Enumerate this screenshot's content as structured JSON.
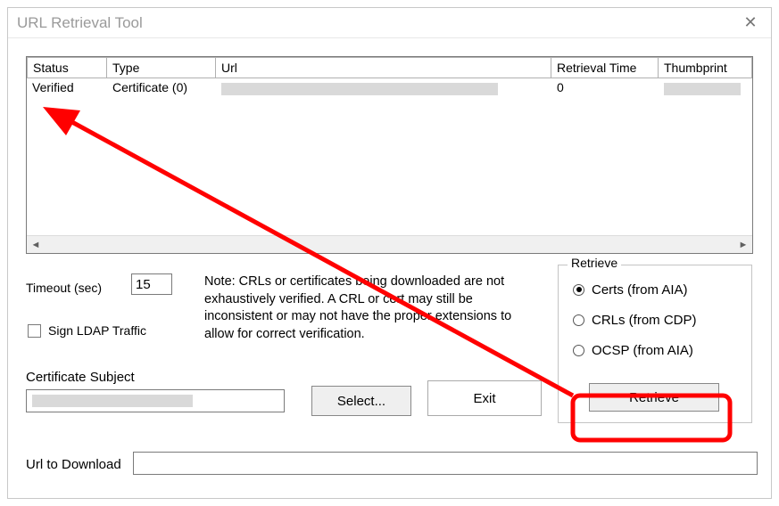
{
  "window": {
    "title": "URL Retrieval Tool"
  },
  "table": {
    "headers": {
      "status": "Status",
      "type": "Type",
      "url": "Url",
      "retrieval_time": "Retrieval Time",
      "thumbprint": "Thumbprint"
    },
    "rows": [
      {
        "status": "Verified",
        "type": "Certificate (0)",
        "url": "",
        "retrieval_time": "0",
        "thumbprint": ""
      }
    ]
  },
  "form": {
    "timeout_label": "Timeout (sec)",
    "timeout_value": "15",
    "sign_ldap_label": "Sign LDAP Traffic",
    "note": "Note: CRLs or certificates being downloaded are not exhaustively verified.  A CRL or cert may still be inconsistent or may not have the proper extensions to allow for correct verification.",
    "certificate_subject_label": "Certificate Subject",
    "select_button": "Select...",
    "exit_button": "Exit",
    "url_to_download_label": "Url to Download"
  },
  "retrieve_group": {
    "legend": "Retrieve",
    "options": {
      "certs": "Certs (from AIA)",
      "crls": "CRLs (from CDP)",
      "ocsp": "OCSP (from AIA)"
    },
    "selected": "certs",
    "button": "Retrieve"
  },
  "annotation": {
    "color": "#ff0000",
    "highlight": "retrieve-button",
    "arrow_target": "status-cell"
  }
}
